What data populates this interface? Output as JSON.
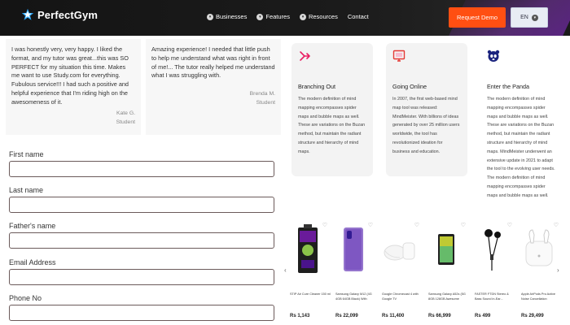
{
  "header": {
    "logo_text": "PerfectGym",
    "nav": [
      "Businesses",
      "Features",
      "Resources",
      "Contact"
    ],
    "demo_label": "Request Demo",
    "lang_label": "EN",
    "colors": {
      "bar": "#141414",
      "demo": "#ff4f12",
      "accent": "#9b3fd6"
    }
  },
  "testimonials": [
    {
      "text": "I was honestly very, very happy. I liked the format, and my tutor was great...this was SO PERFECT for my situation this time. Makes me want to use Study.com for everything. Fubulous service!!! I had such a positive and helpful experience that I'm riding high on the awesomeness of it.",
      "name": "Kate G.",
      "role": "Student"
    },
    {
      "text": "Amazing experience! I needed that little push to help me understand what was right in front of me!... The tutor really helped me understand what I was struggling with.",
      "name": "Brenda M.",
      "role": "Student"
    }
  ],
  "form": {
    "fields": [
      {
        "label": "First name",
        "value": ""
      },
      {
        "label": "Last name",
        "value": ""
      },
      {
        "label": "Father's name",
        "value": ""
      },
      {
        "label": "Email Address",
        "value": ""
      },
      {
        "label": "Phone No",
        "value": ""
      }
    ]
  },
  "cards": [
    {
      "icon": "branch-icon",
      "title": "Branching Out",
      "text": "The modern definition of mind mapping encompasses spider maps and bubble maps as well. These are variations on the Buzan method, but maintain the radiant structure and hierarchy of mind maps."
    },
    {
      "icon": "monitor-icon",
      "title": "Going Online",
      "text": "In 2007, the first web-based mind map tool was released: MindMeister. With billions of ideas generated by over 25 million users worldwide, the tool has revolutionized ideation for business and education."
    },
    {
      "icon": "panda-icon",
      "title": "Enter the Panda",
      "text": "The modern definition of mind mapping encompasses spider maps and bubble maps as well. These are variations on the Buzan method, but maintain the radiant structure and hierarchy of mind maps. MindMeister underwent an extensive update in 2021 to adapt the tool to the evolving user needs. The modern definition of mind mapping encompasses spider maps and bubble maps as well."
    }
  ],
  "products": [
    {
      "name": "STIP Air Cure Cleaner 150 ml",
      "price": "Rs 1,143",
      "image": "cleaner-spray"
    },
    {
      "name": "Samsung Galaxy M12 (4G 4GB 64GB Black) With",
      "price": "Rs 22,099",
      "image": "purple-phone"
    },
    {
      "name": "Google Chromecast 4 with Google TV",
      "price": "Rs 11,400",
      "image": "chromecast"
    },
    {
      "name": "Samsung Galaxy A52s (5G 8GB 128GB Awesome",
      "price": "Rs 66,999",
      "image": "green-phone"
    },
    {
      "name": "FASTER FTDN Stereo & Bass Sound in-Ear...",
      "price": "Rs 499",
      "image": "earphones"
    },
    {
      "name": "Apple AirPods Pro Active Noise Cancellation",
      "price": "Rs 29,499",
      "image": "airpods"
    }
  ]
}
